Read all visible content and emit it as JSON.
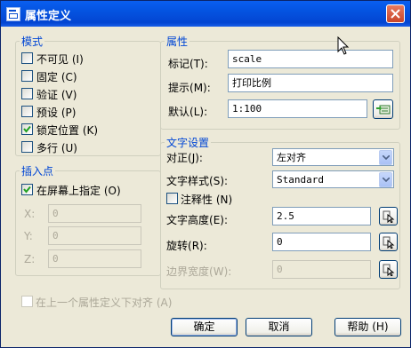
{
  "window": {
    "title": "属性定义",
    "icon": "dialog-icon"
  },
  "mode": {
    "label": "模式",
    "items": [
      {
        "label": "不可见",
        "key": "(I)",
        "checked": false
      },
      {
        "label": "固定",
        "key": "(C)",
        "checked": false
      },
      {
        "label": "验证",
        "key": "(V)",
        "checked": false
      },
      {
        "label": "预设",
        "key": "(P)",
        "checked": false
      },
      {
        "label": "锁定位置",
        "key": "(K)",
        "checked": true
      },
      {
        "label": "多行",
        "key": "(U)",
        "checked": false
      }
    ]
  },
  "insertion": {
    "label": "插入点",
    "on_screen": {
      "label": "在屏幕上指定",
      "key": "(O)",
      "checked": true
    },
    "x": {
      "label": "X:",
      "value": "0"
    },
    "y": {
      "label": "Y:",
      "value": "0"
    },
    "z": {
      "label": "Z:",
      "value": "0"
    }
  },
  "attribute": {
    "label": "属性",
    "tag": {
      "label": "标记",
      "key": "(T):",
      "value": "scale"
    },
    "prompt": {
      "label": "提示",
      "key": "(M):",
      "value": "打印比例"
    },
    "default": {
      "label": "默认",
      "key": "(L):",
      "value": "1:100"
    }
  },
  "text_settings": {
    "label": "文字设置",
    "justify": {
      "label": "对正",
      "key": "(J):",
      "value": "左对齐"
    },
    "style": {
      "label": "文字样式",
      "key": "(S):",
      "value": "Standard"
    },
    "annotative": {
      "label": "注释性",
      "key": "(N)",
      "checked": false
    },
    "height": {
      "label": "文字高度",
      "key": "(E):",
      "value": "2.5"
    },
    "rotation": {
      "label": "旋转",
      "key": "(R):",
      "value": "0"
    },
    "boundary": {
      "label": "边界宽度",
      "key": "(W):",
      "value": "0"
    }
  },
  "align_below": {
    "label": "在上一个属性定义下对齐",
    "key": "(A)",
    "checked": false
  },
  "buttons": {
    "ok": "确定",
    "cancel": "取消",
    "help": "帮助 (H)"
  }
}
